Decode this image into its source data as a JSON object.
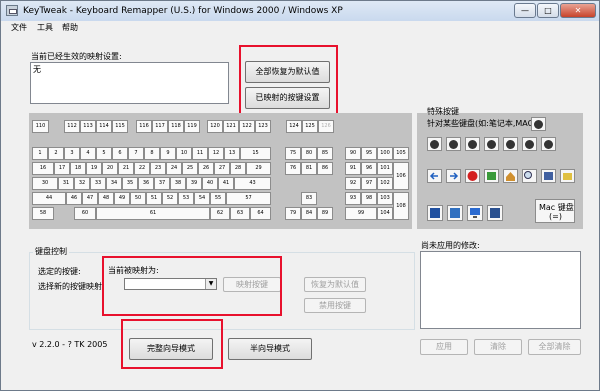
{
  "window": {
    "title": "KeyTweak -  Keyboard Remapper (U.S.)  for Windows 2000 / Windows XP",
    "min_label": "—",
    "max_label": "□",
    "close_label": "✕"
  },
  "menu": [
    "文件",
    "工具",
    "帮助"
  ],
  "current_mappings": {
    "label": "当前已经生效的映射设置:",
    "items": [
      "无"
    ]
  },
  "top_buttons": {
    "restore_all": "全部恢复为默认值",
    "remapped_settings": "已映射的按键设置"
  },
  "keyboard": {
    "fn_row": [
      "110",
      "112",
      "113",
      "114",
      "115",
      "116",
      "117",
      "118",
      "119",
      "120",
      "121",
      "122",
      "123",
      "124",
      "125",
      "126"
    ],
    "row1": [
      "1",
      "2",
      "3",
      "4",
      "5",
      "6",
      "7",
      "8",
      "9",
      "10",
      "11",
      "12",
      "13",
      "15"
    ],
    "row2": [
      "16",
      "17",
      "18",
      "19",
      "20",
      "21",
      "22",
      "23",
      "24",
      "25",
      "26",
      "27",
      "28",
      "29"
    ],
    "row3": [
      "30",
      "31",
      "32",
      "33",
      "34",
      "35",
      "36",
      "37",
      "38",
      "39",
      "40",
      "41",
      "43"
    ],
    "row4": [
      "44",
      "46",
      "47",
      "48",
      "49",
      "50",
      "51",
      "52",
      "53",
      "54",
      "55",
      "57"
    ],
    "row5": [
      "58",
      "60",
      "61",
      "62",
      "63",
      "64"
    ],
    "nav_top": [
      "75",
      "80",
      "85",
      "76",
      "81",
      "86"
    ],
    "arrows": [
      "83",
      "79",
      "84",
      "89"
    ],
    "numpad": [
      "90",
      "95",
      "100",
      "105",
      "91",
      "96",
      "101",
      "106",
      "92",
      "97",
      "102",
      "93",
      "98",
      "103",
      "108",
      "99",
      "104"
    ]
  },
  "special": {
    "title": "特殊按键",
    "subtitle": "针对某些键盘(如:笔记本,MAC)",
    "mac_label": "Mac 键盘",
    "mac_sub": "(=)"
  },
  "control": {
    "legend": "键盘控制",
    "selected_key_label": "选定的按键:",
    "new_mapping_label": "选择新的按键映射",
    "current_mapping_label": "当前被映射为:",
    "combo_value": "",
    "remap_button": "映射按键",
    "restore_default_button": "恢复为默认值",
    "disable_button": "禁用按键"
  },
  "pending": {
    "label": "尚未应用的修改:"
  },
  "version": "v 2.2.0 - ? TK 2005",
  "bottom": {
    "full_wizard": "完整向导模式",
    "half_wizard": "半向导模式",
    "apply": "应用",
    "clear": "清除",
    "clear_all": "全部清除"
  },
  "colors": {
    "highlight": "#e8112d",
    "panel": "#c2c2c2",
    "window_bg": "#f0f0f0"
  }
}
